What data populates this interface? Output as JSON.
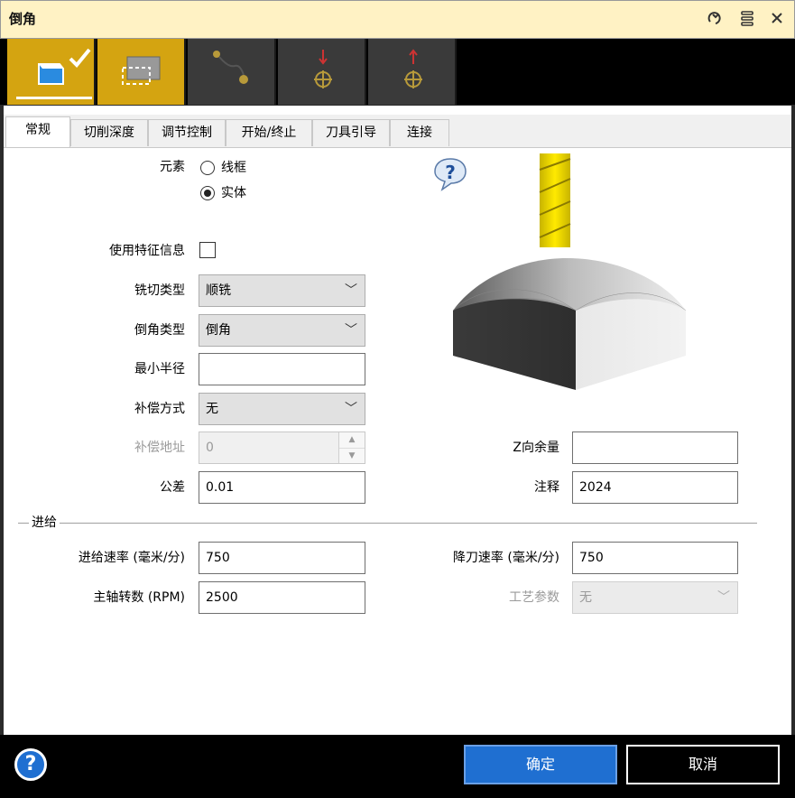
{
  "window": {
    "title": "倒角"
  },
  "titlebar_icons": [
    "refresh-icon",
    "menu-icon",
    "close-icon"
  ],
  "toolbar_buttons": [
    {
      "name": "toolbar-element-solid",
      "state": "on"
    },
    {
      "name": "toolbar-element-region",
      "state": "on"
    },
    {
      "name": "toolbar-path",
      "state": "off"
    },
    {
      "name": "toolbar-start-point",
      "state": "off"
    },
    {
      "name": "toolbar-end-point",
      "state": "off"
    }
  ],
  "tabs": [
    "常规",
    "切削深度",
    "调节控制",
    "开始/终止",
    "刀具引导",
    "连接"
  ],
  "form": {
    "element_label": "元素",
    "element_options": [
      "线框",
      "实体"
    ],
    "element_selected": "实体",
    "use_feature_label": "使用特征信息",
    "use_feature_checked": false,
    "milling_type_label": "铣切类型",
    "milling_type_value": "顺铣",
    "chamfer_type_label": "倒角类型",
    "chamfer_type_value": "倒角",
    "min_radius_label": "最小半径",
    "min_radius_value": "",
    "comp_method_label": "补偿方式",
    "comp_method_value": "无",
    "comp_address_label": "补偿地址",
    "comp_address_value": "0",
    "tolerance_label": "公差",
    "tolerance_value": "0.01",
    "z_allowance_label": "Z向余量",
    "z_allowance_value": "",
    "comment_label": "注释",
    "comment_value": "2024"
  },
  "feed": {
    "section_label": "进给",
    "feed_rate_label": "进给速率 (毫米/分)",
    "feed_rate_value": "750",
    "plunge_rate_label": "降刀速率 (毫米/分)",
    "plunge_rate_value": "750",
    "spindle_label": "主轴转数 (RPM)",
    "spindle_value": "2500",
    "process_param_label": "工艺参数",
    "process_param_value": "无"
  },
  "buttons": {
    "ok": "确定",
    "cancel": "取消",
    "help": "?"
  },
  "colors": {
    "accent": "#d4a411",
    "primary_button": "#1f6fd1",
    "title_bg": "#fff2c4"
  }
}
